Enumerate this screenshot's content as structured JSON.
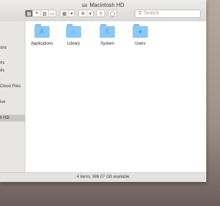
{
  "window": {
    "title": "Macintosh HD"
  },
  "toolbar": {
    "view_icons": [
      "icon-view",
      "list-view",
      "column-view",
      "gallery-view"
    ],
    "group_label": "▾",
    "action_label": "▾",
    "search_placeholder": "Search"
  },
  "sidebar": {
    "items": [
      {
        "label": "ons"
      },
      {
        "label": "rts"
      },
      {
        "label": "ds"
      },
      {
        "label": "Cloud Files"
      },
      {
        "label": "ive"
      },
      {
        "label": "h HD"
      }
    ]
  },
  "files": [
    {
      "name": "Applications",
      "icon": "applications-icon",
      "glyph": "A"
    },
    {
      "name": "Library",
      "icon": "library-icon",
      "glyph": "⌂"
    },
    {
      "name": "System",
      "icon": "system-icon",
      "glyph": "X"
    },
    {
      "name": "Users",
      "icon": "users-icon",
      "glyph": "●"
    }
  ],
  "status": {
    "text": "4 items, 986.07 GB available"
  },
  "colors": {
    "folder": "#8cc8f3",
    "folder_glyph": "#5d9ed0",
    "sidebar_selected": "#c9c7c6"
  }
}
